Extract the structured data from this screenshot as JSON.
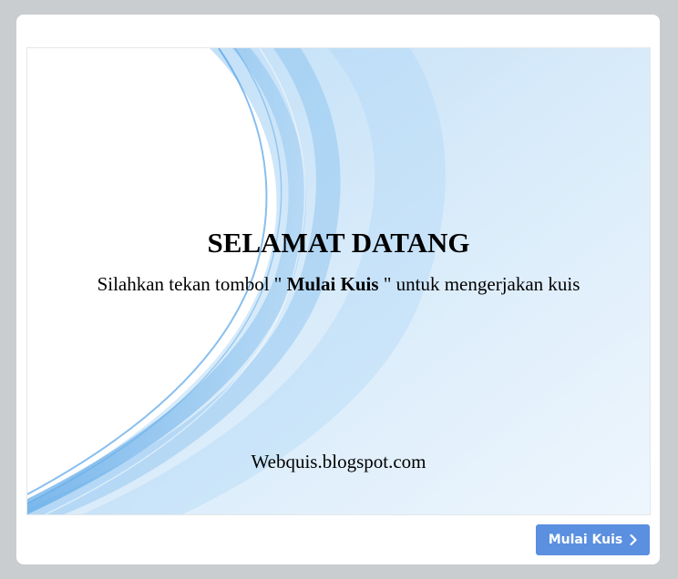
{
  "slide": {
    "title": "SELAMAT DATANG",
    "subtitle_prefix": "Silahkan tekan tombol \" ",
    "subtitle_bold": "Mulai Kuis",
    "subtitle_suffix": " \" untuk mengerjakan kuis",
    "footer": "Webquis.blogspot.com"
  },
  "start_button": {
    "label": "Mulai Kuis",
    "icon": "chevron-right-icon"
  },
  "colors": {
    "page_background": "#c9cdd0",
    "card_background": "#ffffff",
    "button_background": "#5b8fe0",
    "wave_blue": "#4aa3e8"
  }
}
